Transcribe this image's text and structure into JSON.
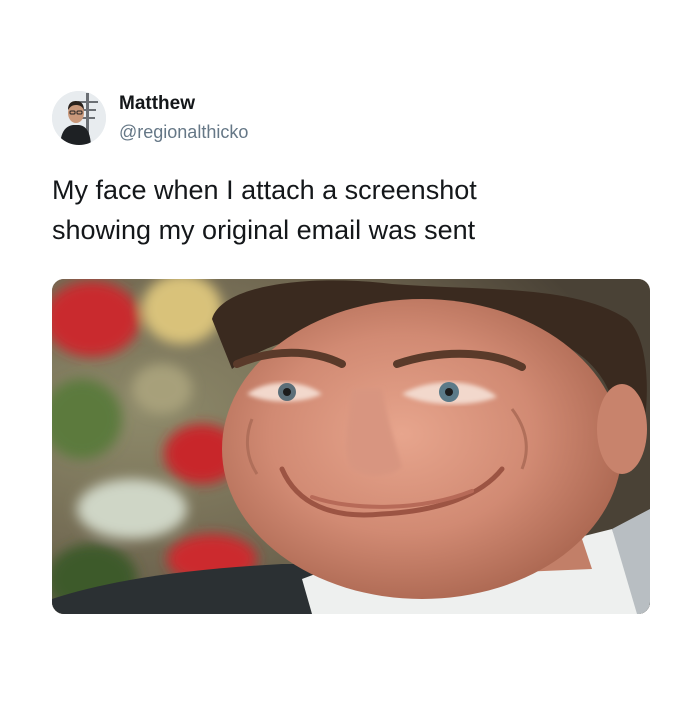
{
  "tweet": {
    "author": {
      "display_name": "Matthew",
      "handle": "@regionalthicko",
      "avatar_icon": "profile-photo"
    },
    "text_lines": [
      "My face when I attach a screenshot",
      "showing my original email was sent"
    ],
    "media": {
      "type": "photo",
      "icon": "smirking-man-photo"
    }
  },
  "colors": {
    "background": "#ffffff",
    "text_primary": "#14171a",
    "text_secondary": "#657786"
  }
}
